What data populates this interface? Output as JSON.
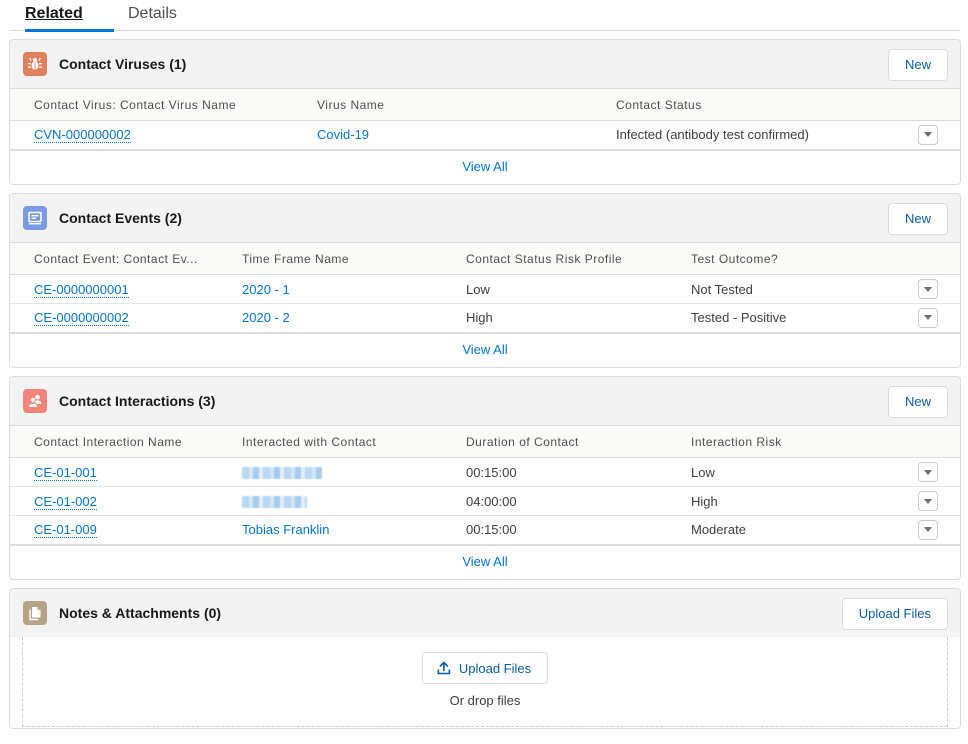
{
  "tabs": [
    {
      "label": "Related",
      "active": true
    },
    {
      "label": "Details",
      "active": false
    }
  ],
  "colors": {
    "accent": "#0176d3",
    "virus_icon": "#e07f5b",
    "event_icon": "#7a9ae6",
    "interaction_icon": "#f4837a",
    "notes_icon": "#b6a385"
  },
  "contact_viruses": {
    "title": "Contact Viruses (1)",
    "icon": "bug-icon",
    "new_label": "New",
    "columns": [
      "Contact Virus: Contact Virus Name",
      "Virus Name",
      "Contact Status"
    ],
    "rows": [
      {
        "name": "CVN-000000002",
        "virus": "Covid-19",
        "status": "Infected (antibody test confirmed)"
      }
    ],
    "view_all": "View All"
  },
  "contact_events": {
    "title": "Contact Events (2)",
    "icon": "event-icon",
    "new_label": "New",
    "columns": [
      "Contact Event: Contact Ev...",
      "Time Frame Name",
      "Contact Status Risk Profile",
      "Test Outcome?"
    ],
    "rows": [
      {
        "name": "CE-0000000001",
        "time_frame": "2020 - 1",
        "risk": "Low",
        "outcome": "Not Tested"
      },
      {
        "name": "CE-0000000002",
        "time_frame": "2020 - 2",
        "risk": "High",
        "outcome": "Tested - Positive"
      }
    ],
    "view_all": "View All"
  },
  "contact_interactions": {
    "title": "Contact Interactions (3)",
    "icon": "people-icon",
    "new_label": "New",
    "columns": [
      "Contact Interaction Name",
      "Interacted with Contact",
      "Duration of Contact",
      "Interaction Risk"
    ],
    "rows": [
      {
        "name": "CE-01-001",
        "contact": null,
        "contact_redacted": true,
        "duration": "00:15:00",
        "risk": "Low"
      },
      {
        "name": "CE-01-002",
        "contact": null,
        "contact_redacted": true,
        "duration": "04:00:00",
        "risk": "High"
      },
      {
        "name": "CE-01-009",
        "contact": "Tobias Franklin",
        "contact_redacted": false,
        "duration": "00:15:00",
        "risk": "Moderate"
      }
    ],
    "view_all": "View All"
  },
  "notes_attachments": {
    "title": "Notes & Attachments (0)",
    "icon": "file-icon",
    "header_button": "Upload Files",
    "upload_button": "Upload Files",
    "drop_text": "Or drop files"
  }
}
